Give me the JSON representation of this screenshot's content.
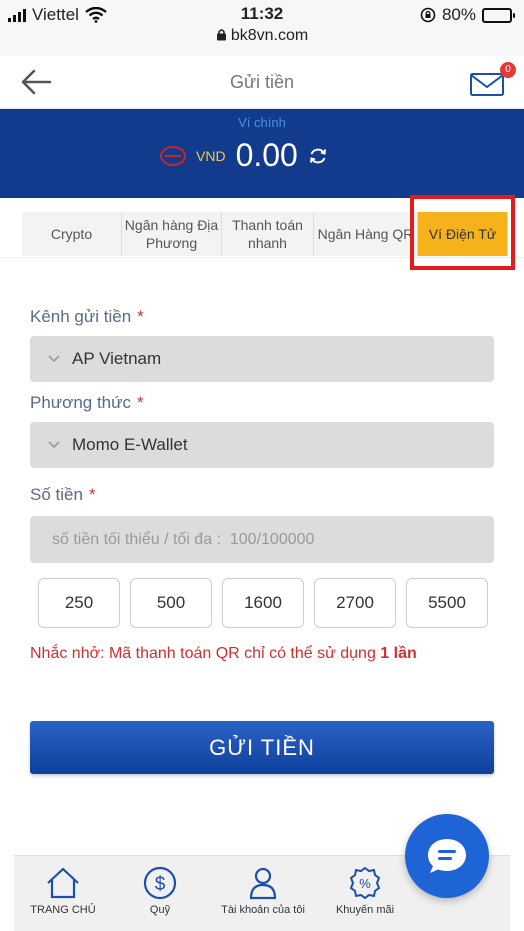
{
  "status_bar": {
    "carrier": "Viettel",
    "time": "11:32",
    "url": "bk8vn.com",
    "battery": "80%"
  },
  "header": {
    "title": "Gửi tiền",
    "notification_count": "0"
  },
  "wallet": {
    "label": "Ví chính",
    "currency": "VND",
    "balance": "0.00"
  },
  "tabs": [
    {
      "label": "Crypto"
    },
    {
      "label": "Ngân hàng Địa Phương"
    },
    {
      "label": "Thanh toán nhanh"
    },
    {
      "label": "Ngân Hàng QR"
    },
    {
      "label": "Ví Điện Tử",
      "active": true
    }
  ],
  "form": {
    "channel_label": "Kênh gửi tiền",
    "channel_value": "AP Vietnam",
    "method_label": "Phương thức",
    "method_value": "Momo E-Wallet",
    "amount_label": "Số tiền",
    "amount_placeholder": "số tiền tối thiểu / tối đa :  100/100000",
    "required_mark": "*",
    "quick_amounts": [
      "250",
      "500",
      "1600",
      "2700",
      "5500"
    ],
    "notice_text": "Nhắc nhở: Mã thanh toán QR chỉ có thể sử dụng",
    "notice_bold": "1 lần",
    "submit_label": "GỬI TIỀN"
  },
  "bottom_nav": [
    {
      "label": "TRANG CHỦ",
      "icon": "home-icon"
    },
    {
      "label": "Quỹ",
      "icon": "dollar-icon"
    },
    {
      "label": "Tài khoản của tôi",
      "icon": "user-icon"
    },
    {
      "label": "Khuyến mãi",
      "icon": "promo-icon"
    }
  ],
  "colors": {
    "brand_blue": "#123a8d",
    "active_tab": "#f5b21b",
    "highlight_red": "#e51b1b",
    "notice_red": "#d32f2f"
  }
}
